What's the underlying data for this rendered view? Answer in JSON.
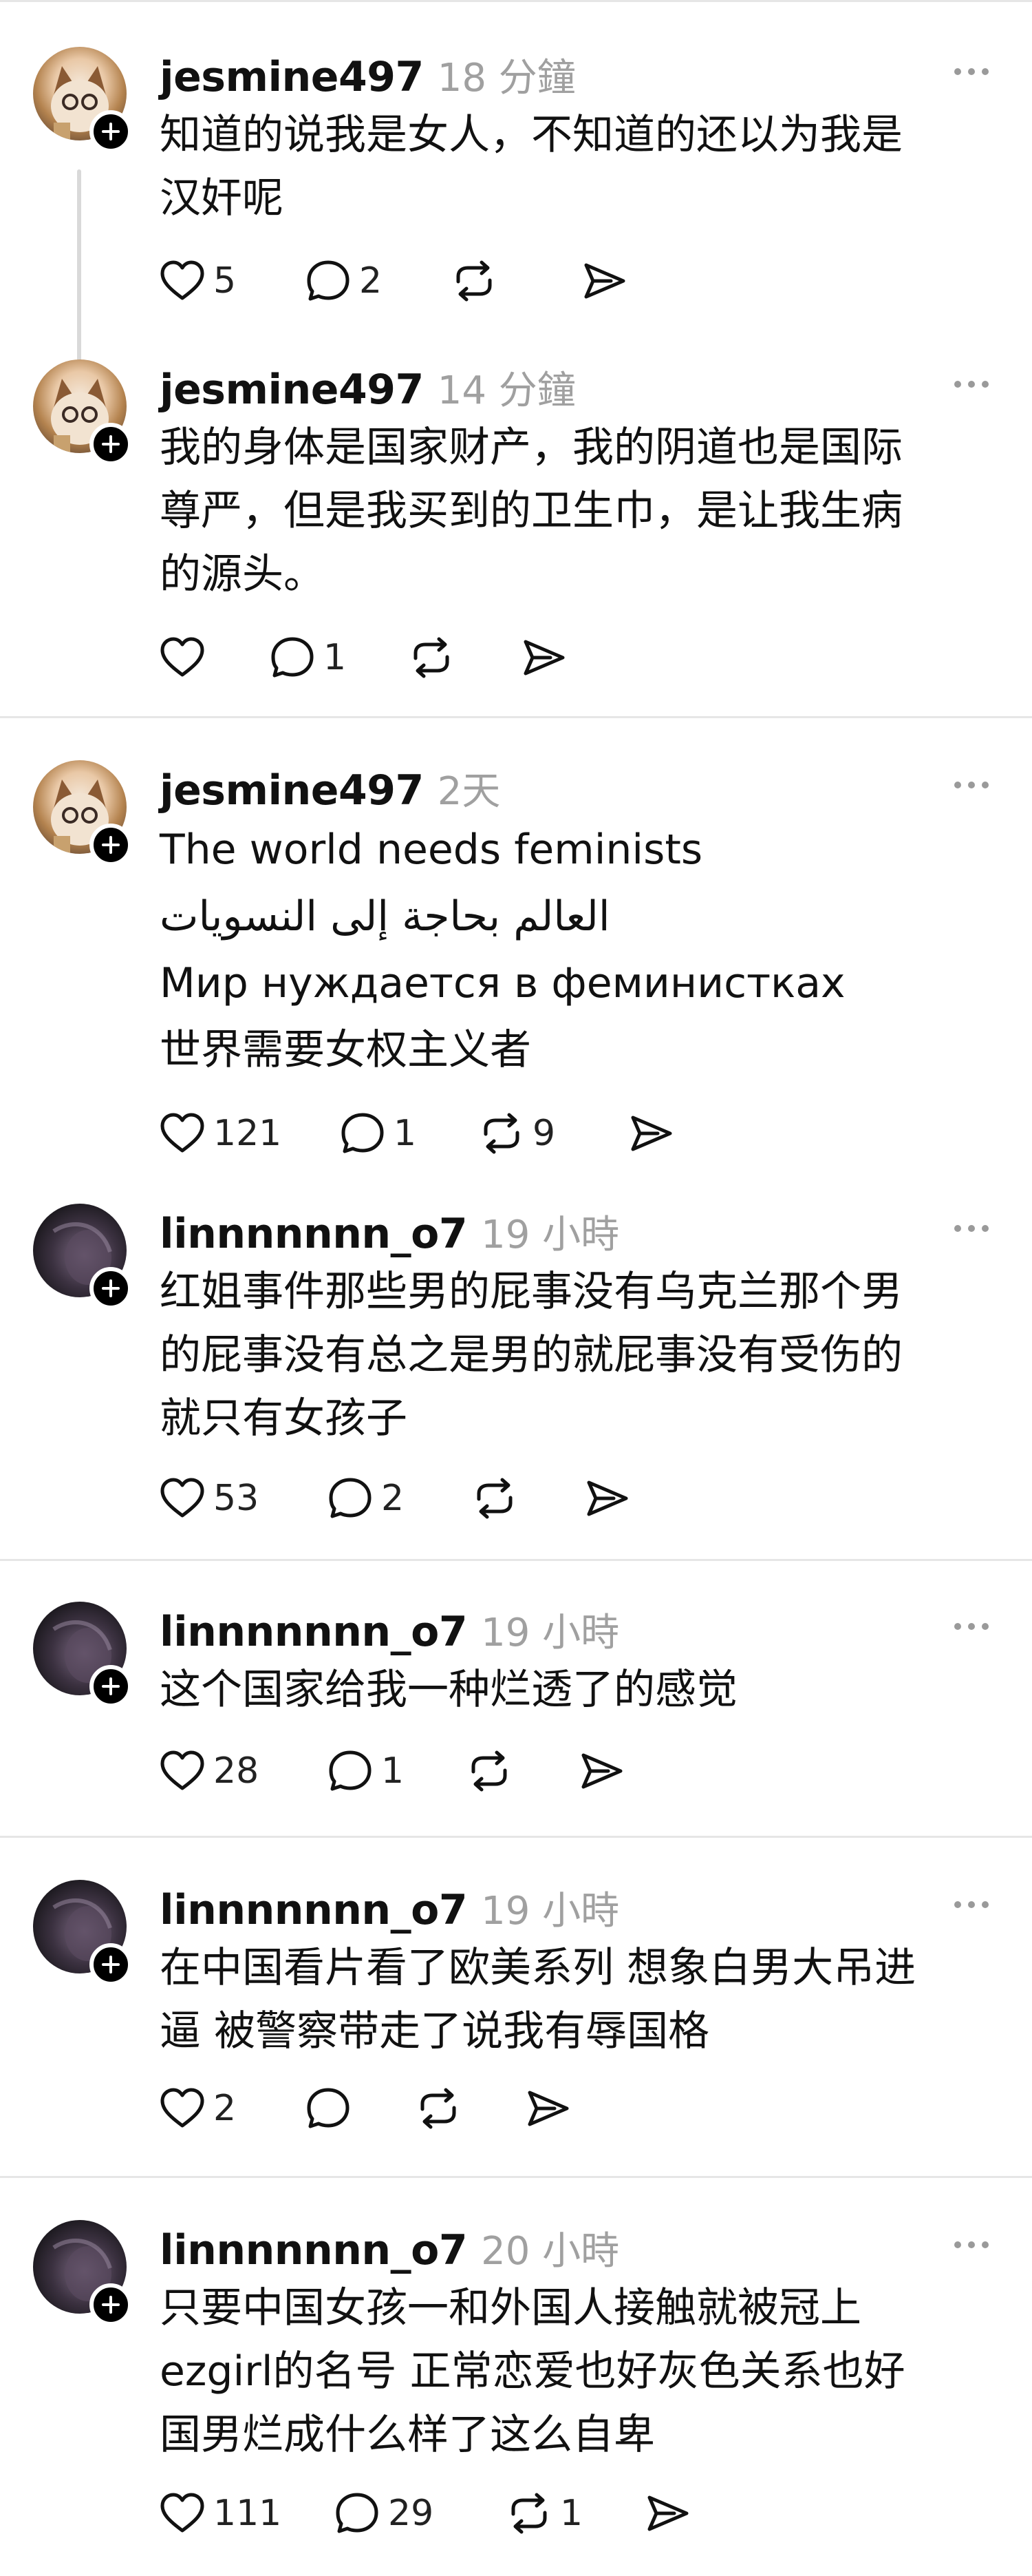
{
  "colors": {
    "text": "#111111",
    "muted": "#a0a0a0",
    "divider": "#e6e6e6",
    "thread_line": "#d9d9d9"
  },
  "posts": [
    {
      "username": "jesmine497",
      "time": "18 分鐘",
      "lines": [
        "知道的说我是女人，不知道的还以为我是",
        "汉奸呢"
      ],
      "likes": "5",
      "replies": "2",
      "reposts": ""
    },
    {
      "username": "jesmine497",
      "time": "14 分鐘",
      "lines": [
        "我的身体是国家财产，我的阴道也是国际",
        "尊严，但是我买到的卫生巾，是让我生病",
        "的源头。"
      ],
      "likes": "",
      "replies": "1",
      "reposts": ""
    },
    {
      "username": "jesmine497",
      "time": "2天",
      "lines": [
        "The world needs feminists",
        "العالم بحاجة إلى النسويات",
        "Мир нуждается в феминистках",
        "世界需要女权主义者"
      ],
      "likes": "121",
      "replies": "1",
      "reposts": "9"
    },
    {
      "username": "linnnnnnn_o7",
      "time": "19 小時",
      "lines": [
        "红姐事件那些男的屁事没有乌克兰那个男",
        "的屁事没有总之是男的就屁事没有受伤的",
        "就只有女孩子"
      ],
      "likes": "53",
      "replies": "2",
      "reposts": ""
    },
    {
      "username": "linnnnnnn_o7",
      "time": "19 小時",
      "lines": [
        "这个国家给我一种烂透了的感觉"
      ],
      "likes": "28",
      "replies": "1",
      "reposts": ""
    },
    {
      "username": "linnnnnnn_o7",
      "time": "19 小時",
      "lines": [
        "在中国看片看了欧美系列 想象白男大吊进",
        "逼 被警察带走了说我有辱国格"
      ],
      "likes": "2",
      "replies": "",
      "reposts": ""
    },
    {
      "username": "linnnnnnn_o7",
      "time": "20 小時",
      "lines": [
        "只要中国女孩一和外国人接触就被冠上",
        "ezgirl的名号  正常恋爱也好灰色关系也好",
        "国男烂成什么样了这么自卑"
      ],
      "likes": "111",
      "replies": "29",
      "reposts": "1"
    }
  ],
  "icons": {
    "like": "heart-icon",
    "reply": "comment-bubble-icon",
    "repost": "repost-icon",
    "share": "share-send-icon",
    "more": "more-dots-icon",
    "follow": "follow-plus-icon"
  }
}
